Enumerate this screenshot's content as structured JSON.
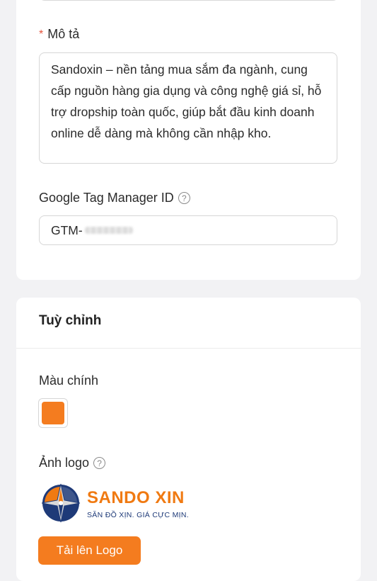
{
  "description_field": {
    "required_mark": "*",
    "label": "Mô tả",
    "value": "Sandoxin – nền tảng mua sắm đa ngành, cung cấp nguồn hàng gia dụng và công nghệ giá sỉ, hỗ trợ dropship toàn quốc, giúp bắt đầu kinh doanh online dễ dàng mà không cần nhập kho."
  },
  "gtm_field": {
    "label": "Google Tag Manager ID",
    "help_icon": "question-circle-icon",
    "value_prefix": "GTM-"
  },
  "customize": {
    "title": "Tuỳ chỉnh",
    "primary_color_label": "Màu chính",
    "primary_color": "#f47c1f",
    "logo_label": "Ảnh logo",
    "logo_help_icon": "question-circle-icon",
    "logo_brand": "SANDO XIN",
    "logo_slogan": "SĂN ĐỒ XỊN. GIÁ CỰC MỊN.",
    "upload_button": "Tải lên Logo"
  },
  "colors": {
    "accent": "#f47c1f",
    "logo_navy": "#1e3a78",
    "background": "#f2f2f4"
  }
}
